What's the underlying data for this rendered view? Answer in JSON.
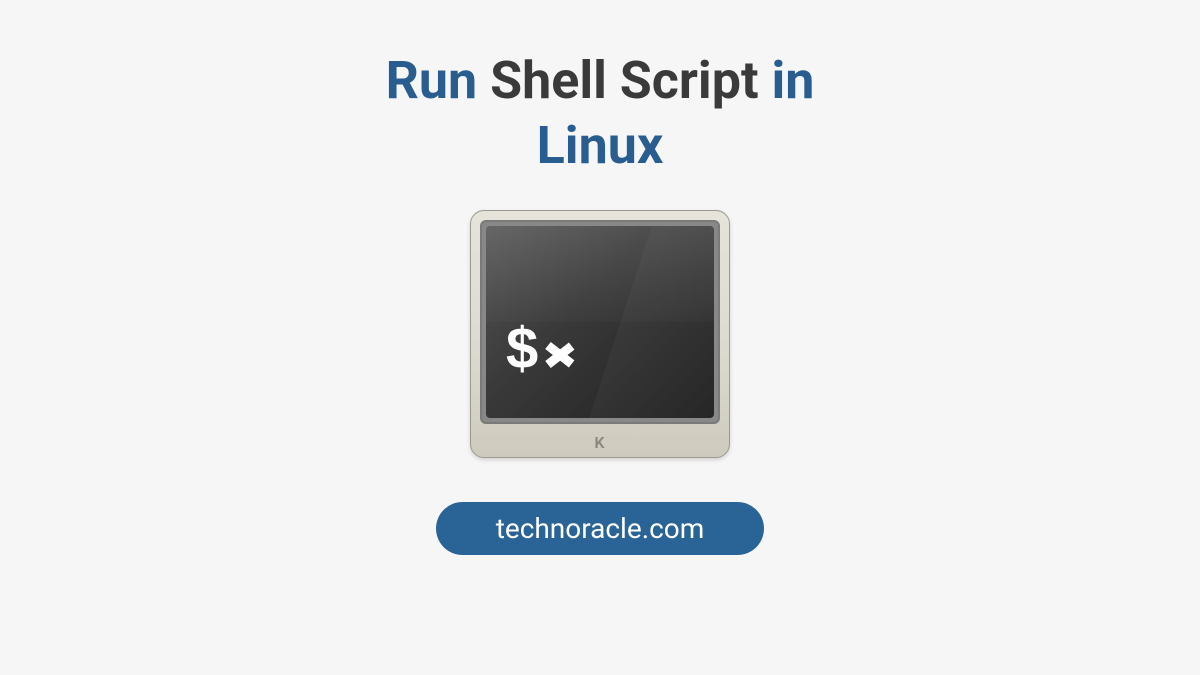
{
  "title": {
    "word1": "Run",
    "word2": "Shell Script",
    "word3": "in",
    "line2": "Linux"
  },
  "terminal": {
    "prompt_symbol": "$",
    "brand_letter": "K"
  },
  "badge": {
    "text": "technoracle.com"
  }
}
